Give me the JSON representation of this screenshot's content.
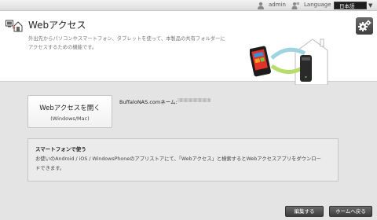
{
  "topbar": {
    "user_icon": "user-icon",
    "user_label": "admin",
    "language_icon": "language-icon",
    "language_label": "Language",
    "language_value": "日本語"
  },
  "header": {
    "title": "Webアクセス",
    "description_line1": "外出先からパソコンやスマートフォン、タブレットを使って、本製品の共有フォルダーに",
    "description_line2": "アクセスするための機能です。",
    "settings_icon": "gear-icon"
  },
  "main": {
    "open_button_label": "Webアクセスを開く",
    "open_button_sub": "(Windows/Mac)",
    "nas_name_label": "BuffaloNAS.comネーム:"
  },
  "smartphone": {
    "title": "スマートフォンで使う",
    "body_line1": "お使いのAndroid / iOS / WindowsPhoneのアプリストアにて、「Webアクセス」と検索するとWebアクセスアプリをダウンロー",
    "body_line2": "ドできます。"
  },
  "footer": {
    "edit_label": "編集する",
    "home_label": "ホームへ戻る"
  },
  "colors": {
    "background": "#e4e4e4",
    "header_bg": "#ffffff",
    "dark_button": "#4a4a4a",
    "accent_red": "#e0322b"
  }
}
